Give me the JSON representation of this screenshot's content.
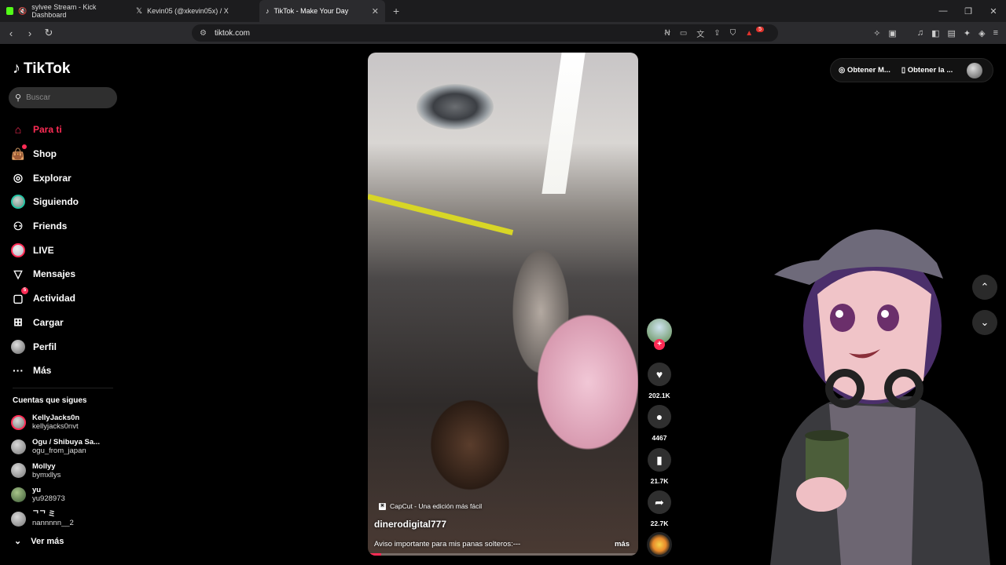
{
  "browser": {
    "tabs": [
      {
        "title": "sylvee Stream - Kick Dashboard",
        "icon": "kick-icon",
        "color": "#53fc18"
      },
      {
        "title": "Kevin05 (@xkevin05x) / X",
        "icon": "x-icon",
        "color": "#ffffff"
      },
      {
        "title": "TikTok - Make Your Day",
        "icon": "tiktok-icon",
        "color": "#ffffff",
        "active": true
      }
    ],
    "url": "tiktok.com",
    "notification_count": "5"
  },
  "tiktok": {
    "logo_text": "TikTok",
    "search_placeholder": "Buscar",
    "menu": [
      {
        "label": "Para ti",
        "icon": "home-icon",
        "active": true
      },
      {
        "label": "Shop",
        "icon": "shop-bag-icon"
      },
      {
        "label": "Explorar",
        "icon": "compass-icon"
      },
      {
        "label": "Siguiendo",
        "icon": "following-avatar"
      },
      {
        "label": "Friends",
        "icon": "friends-icon"
      },
      {
        "label": "LIVE",
        "icon": "live-avatar"
      },
      {
        "label": "Mensajes",
        "icon": "send-icon"
      },
      {
        "label": "Actividad",
        "icon": "activity-icon",
        "badge": "5"
      },
      {
        "label": "Cargar",
        "icon": "upload-icon"
      },
      {
        "label": "Perfil",
        "icon": "profile-avatar"
      },
      {
        "label": "Más",
        "icon": "more-icon"
      }
    ],
    "following_heading": "Cuentas que sigues",
    "following": [
      {
        "name": "KellyJacks0n",
        "handle": "kellyjacks0nvt"
      },
      {
        "name": "Ogu / Shibuya Sa...",
        "handle": "ogu_from_japan"
      },
      {
        "name": "Mollyy",
        "handle": "bymxllys"
      },
      {
        "name": "yu",
        "handle": "yu928973"
      },
      {
        "name": "ᄀᄀ ミ",
        "handle": "nannnnn__2"
      }
    ],
    "see_more": "Ver más",
    "top_right": {
      "get_app_1": "Obtener M...",
      "get_app_2": "Obtener la ..."
    },
    "video": {
      "source_label": "CapCut - Una edición más fácil",
      "username": "dinerodigital777",
      "description": "Aviso importante para mis panas solteros:---",
      "more": "más",
      "progress": 0.05,
      "likes": "202.1K",
      "comments": "4467",
      "saves": "21.7K",
      "shares": "22.7K"
    }
  },
  "colors": {
    "accent": "#fe2c55",
    "background": "#000000",
    "chrome": "#2b2b2e"
  }
}
